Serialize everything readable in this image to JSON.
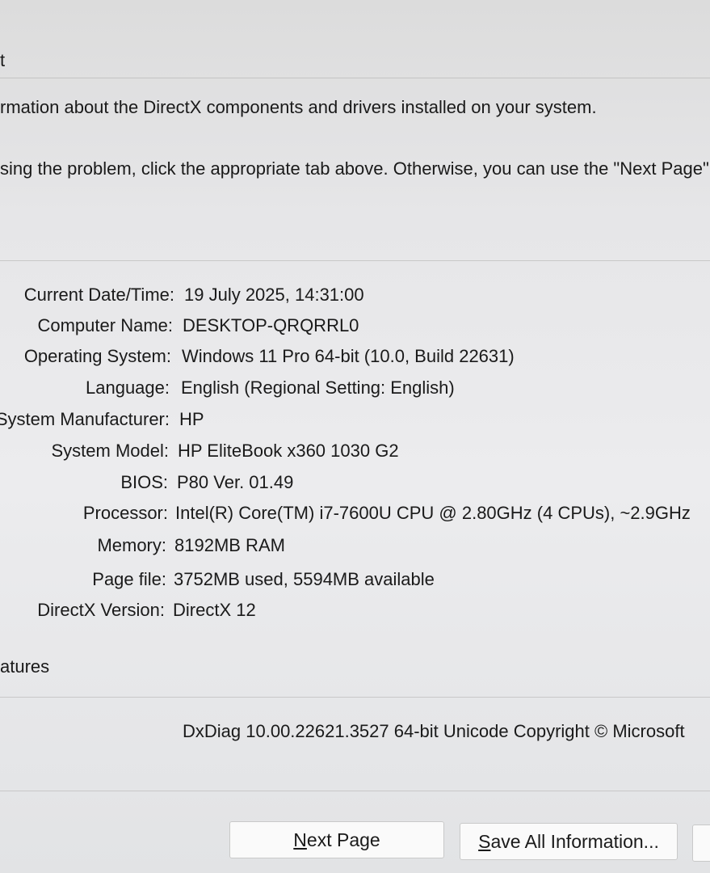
{
  "tab": {
    "fragment": "t"
  },
  "intro": {
    "line1": "rmation about the DirectX components and drivers installed on your system.",
    "line2": "sing the problem, click the appropriate tab above. Otherwise, you can use the \"Next Page\" but"
  },
  "system_info": [
    {
      "label": "Current Date/Time:",
      "value": "19 July 2025, 14:31:00"
    },
    {
      "label": "Computer Name:",
      "value": "DESKTOP-QRQRRL0"
    },
    {
      "label": "Operating System:",
      "value": "Windows 11 Pro 64-bit (10.0, Build 22631)"
    },
    {
      "label": "Language:",
      "value": "English (Regional Setting: English)"
    },
    {
      "label": "System Manufacturer:",
      "value": "HP"
    },
    {
      "label": "System Model:",
      "value": "HP EliteBook x360 1030 G2"
    },
    {
      "label": "BIOS:",
      "value": "P80 Ver. 01.49"
    },
    {
      "label": "Processor:",
      "value": "Intel(R) Core(TM) i7-7600U CPU @ 2.80GHz (4 CPUs), ~2.9GHz"
    },
    {
      "label": "Memory:",
      "value": "8192MB RAM"
    },
    {
      "label": "Page file:",
      "value": "3752MB used, 5594MB available"
    },
    {
      "label": "DirectX Version:",
      "value": "DirectX 12"
    }
  ],
  "features": {
    "label": "atures"
  },
  "footer": {
    "text": "DxDiag 10.00.22621.3527 64-bit Unicode  Copyright © Microsoft"
  },
  "buttons": {
    "next_page": {
      "hotkey": "N",
      "rest": "ext Page"
    },
    "save_all": {
      "hotkey": "S",
      "rest": "ave All Information..."
    }
  }
}
